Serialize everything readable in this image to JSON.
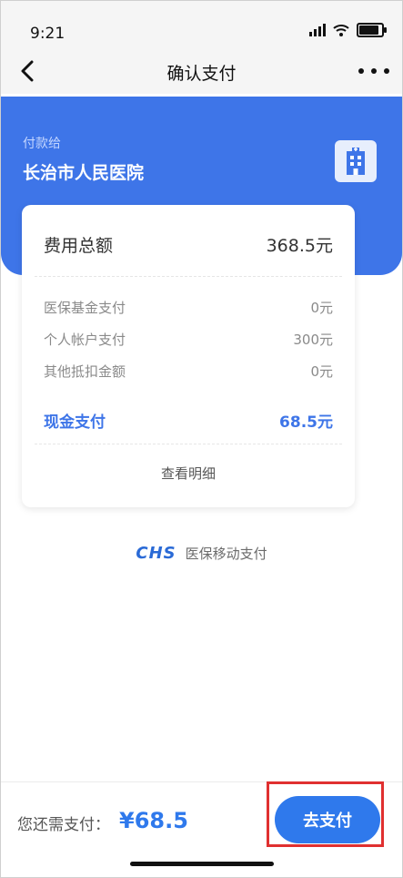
{
  "status_bar": {
    "time": "9:21"
  },
  "nav": {
    "title": "确认支付",
    "back_icon": "chevron-left-icon",
    "more_icon": "more-dots-icon"
  },
  "header": {
    "payee_label": "付款给",
    "payee_name": "长治市人民医院",
    "icon": "hospital-building-icon"
  },
  "card": {
    "total_label": "费用总额",
    "total_value": "368.5元",
    "items": [
      {
        "label": "医保基金支付",
        "value": "0元"
      },
      {
        "label": "个人帐户支付",
        "value": "300元"
      },
      {
        "label": "其他抵扣金额",
        "value": "0元"
      }
    ],
    "cash_label": "现金支付",
    "cash_value": "68.5元",
    "detail_link": "查看明细"
  },
  "brand": {
    "logo": "CHS",
    "text": "医保移动支付"
  },
  "bottom": {
    "due_label": "您还需支付：",
    "due_amount": "¥68.5",
    "pay_button": "去支付"
  },
  "colors": {
    "primary": "#3e75e8",
    "accent": "#2f79ec",
    "highlight": "#e03030"
  }
}
